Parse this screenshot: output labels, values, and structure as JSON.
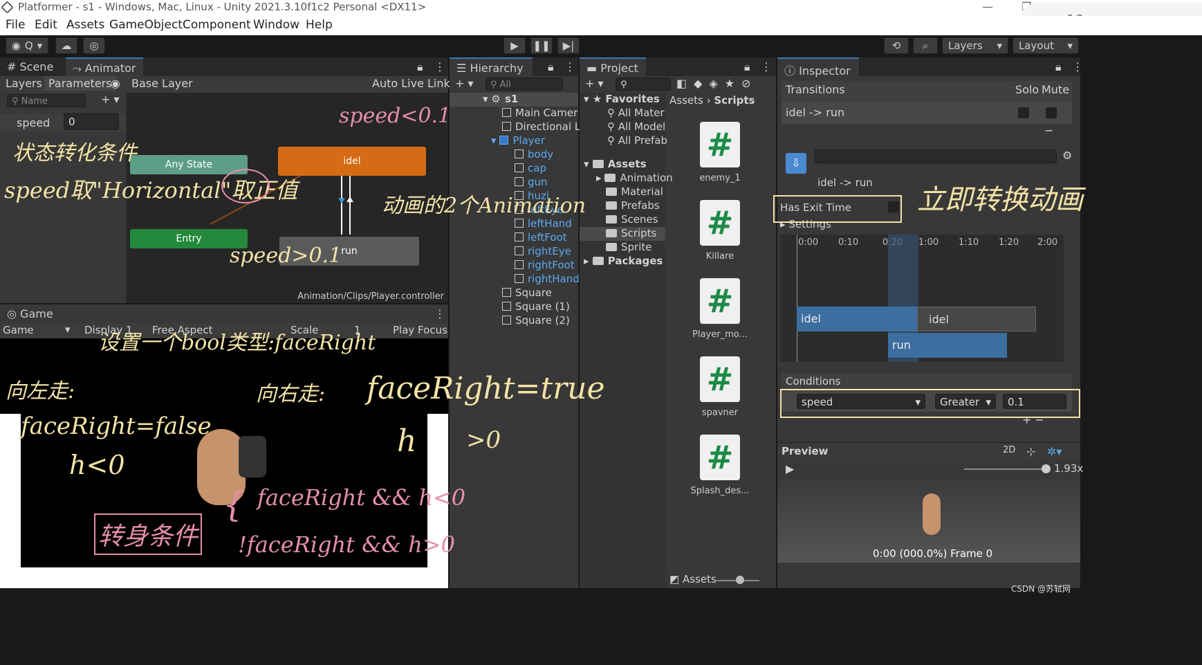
{
  "window": {
    "title": "Platformer - s1 - Windows, Mac, Linux - Unity 2021.3.10f1c2 Personal <DX11>",
    "side_number": "10"
  },
  "menu": [
    "File",
    "Edit",
    "Assets",
    "GameObject",
    "Component",
    "Window",
    "Help"
  ],
  "toolbar": {
    "account": "Q",
    "layers": "Layers",
    "layout": "Layout"
  },
  "animator": {
    "tabs": [
      "Scene",
      "Animator"
    ],
    "subtabs": [
      "Layers",
      "Parameters"
    ],
    "base_layer": "Base Layer",
    "auto_live_link": "Auto Live Link",
    "name_placeholder": "Name",
    "param_name": "speed",
    "param_value": "0",
    "nodes": {
      "any_state": "Any State",
      "entry": "Entry",
      "idel": "idel",
      "run": "run"
    },
    "footer": "Animation/Clips/Player.controller"
  },
  "game": {
    "tab": "Game",
    "display_mode": "Game",
    "display": "Display 1",
    "aspect": "Free Aspect",
    "scale": "Scale",
    "scale_value": "1",
    "play_focus": "Play Focus"
  },
  "hierarchy": {
    "tab": "Hierarchy",
    "search": "All",
    "items": [
      {
        "label": "s1",
        "indent": 0
      },
      {
        "label": "Main Camer",
        "indent": 1
      },
      {
        "label": "Directional L",
        "indent": 1
      },
      {
        "label": "Player",
        "indent": 1
      },
      {
        "label": "body",
        "indent": 2
      },
      {
        "label": "cap",
        "indent": 2
      },
      {
        "label": "gun",
        "indent": 2
      },
      {
        "label": "huzi",
        "indent": 2
      },
      {
        "label": "leftEye",
        "indent": 2
      },
      {
        "label": "leftHand",
        "indent": 2
      },
      {
        "label": "leftFoot",
        "indent": 2
      },
      {
        "label": "rightEye",
        "indent": 2
      },
      {
        "label": "rightFoot",
        "indent": 2
      },
      {
        "label": "rightHand",
        "indent": 2
      },
      {
        "label": "Square",
        "indent": 1
      },
      {
        "label": "Square (1)",
        "indent": 1
      },
      {
        "label": "Square (2)",
        "indent": 1
      }
    ]
  },
  "project": {
    "tab": "Project",
    "favorites": "Favorites",
    "fav_items": [
      "All Mater",
      "All Model",
      "All Prefab"
    ],
    "assets": "Assets",
    "asset_folders": [
      "Animation",
      "Material",
      "Prefabs",
      "Scenes",
      "Scripts",
      "Sprite"
    ],
    "packages": "Packages",
    "breadcrumb": [
      "Assets",
      "Scripts"
    ],
    "scripts": [
      "enemy_1",
      "Killare",
      "Player_mo...",
      "spavner",
      "Splash_des..."
    ],
    "footer": "Assets"
  },
  "inspector": {
    "tab": "Inspector",
    "transitions": "Transitions",
    "solo": "Solo",
    "mute": "Mute",
    "transition": "idel -> run",
    "has_exit_time": "Has Exit Time",
    "settings": "Settings",
    "timeline_ticks": [
      "0:00",
      "0:10",
      "0:20",
      "1:00",
      "1:10",
      "1:20",
      "2:00"
    ],
    "bars": {
      "idel": "idel",
      "run": "run"
    },
    "conditions": "Conditions",
    "cond_param": "speed",
    "cond_op": "Greater",
    "cond_value": "0.1",
    "preview": "Preview",
    "preview_2d": "2D",
    "preview_speed": "1.93x",
    "preview_frame": "0:00 (000.0%) Frame 0"
  },
  "annotations": {
    "state_cond": "状态转化条件",
    "speed_abs": "speed取\"Horizontal\"取正值",
    "speed_lt": "speed<0.1",
    "speed_gt": "speed>0.1",
    "two_anims": "动画的2个Animation",
    "instant": "立即转换动画",
    "bool": "设置一个bool类型:faceRight",
    "left": "向左走:",
    "left_cond": "faceRight=false",
    "left_h": "h<0",
    "right": "向右走:",
    "right_cond": "faceRight=true",
    "right_h": "h",
    "right_h2": ">0",
    "turn": "转身条件",
    "turn1": "faceRight && h<0",
    "turn2": "!faceRight && h>0"
  },
  "watermark": "CSDN @苏轼网"
}
